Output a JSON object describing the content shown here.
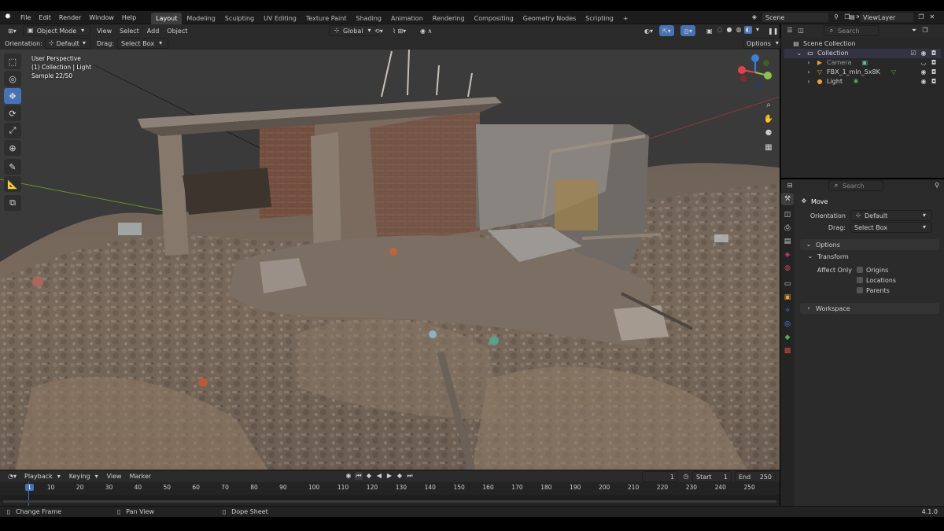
{
  "topbar": {
    "menu": [
      "File",
      "Edit",
      "Render",
      "Window",
      "Help"
    ],
    "workspaces": [
      "Layout",
      "Modeling",
      "Sculpting",
      "UV Editing",
      "Texture Paint",
      "Shading",
      "Animation",
      "Rendering",
      "Compositing",
      "Geometry Nodes",
      "Scripting"
    ],
    "active_workspace": "Layout",
    "scene": "Scene",
    "view_layer": "ViewLayer"
  },
  "viewport_header": {
    "mode": "Object Mode",
    "menu": [
      "View",
      "Select",
      "Add",
      "Object"
    ],
    "transform_orientation": "Global",
    "options_label": "Options"
  },
  "tool_options": {
    "orientation_label": "Orientation:",
    "orientation_value": "Default",
    "drag_label": "Drag:",
    "drag_value": "Select Box"
  },
  "viewport": {
    "perspective": "User Perspective",
    "collection_info": "(1) Collection | Light",
    "sample": "Sample 22/50"
  },
  "outliner": {
    "search_placeholder": "Search",
    "scene_collection": "Scene Collection",
    "collection": "Collection",
    "items": [
      "Camera",
      "FBX_1_mln_5x8K",
      "Light"
    ]
  },
  "properties": {
    "search_placeholder": "Search",
    "tool_name": "Move",
    "orientation_label": "Orientation",
    "orientation_value": "Default",
    "drag_label": "Drag:",
    "drag_value": "Select Box",
    "options_panel": "Options",
    "transform_panel": "Transform",
    "affect_only_label": "Affect Only",
    "affect_only_options": [
      "Origins",
      "Locations",
      "Parents"
    ],
    "workspace_panel": "Workspace"
  },
  "timeline": {
    "menu": [
      "Playback",
      "Keying",
      "View",
      "Marker"
    ],
    "current_frame": "1",
    "start_label": "Start",
    "start_value": "1",
    "end_label": "End",
    "end_value": "250",
    "ruler": [
      "1",
      "10",
      "20",
      "30",
      "40",
      "50",
      "60",
      "70",
      "80",
      "90",
      "100",
      "110",
      "120",
      "130",
      "140",
      "150",
      "160",
      "170",
      "180",
      "190",
      "200",
      "210",
      "220",
      "230",
      "240",
      "250"
    ]
  },
  "statusbar": {
    "hints": [
      "Change Frame",
      "Pan View",
      "Dope Sheet"
    ],
    "version": "4.1.0"
  },
  "colors": {
    "accent": "#4772b3",
    "header_bg": "#2a2a2a",
    "panel_bg": "#2b2b2b"
  }
}
